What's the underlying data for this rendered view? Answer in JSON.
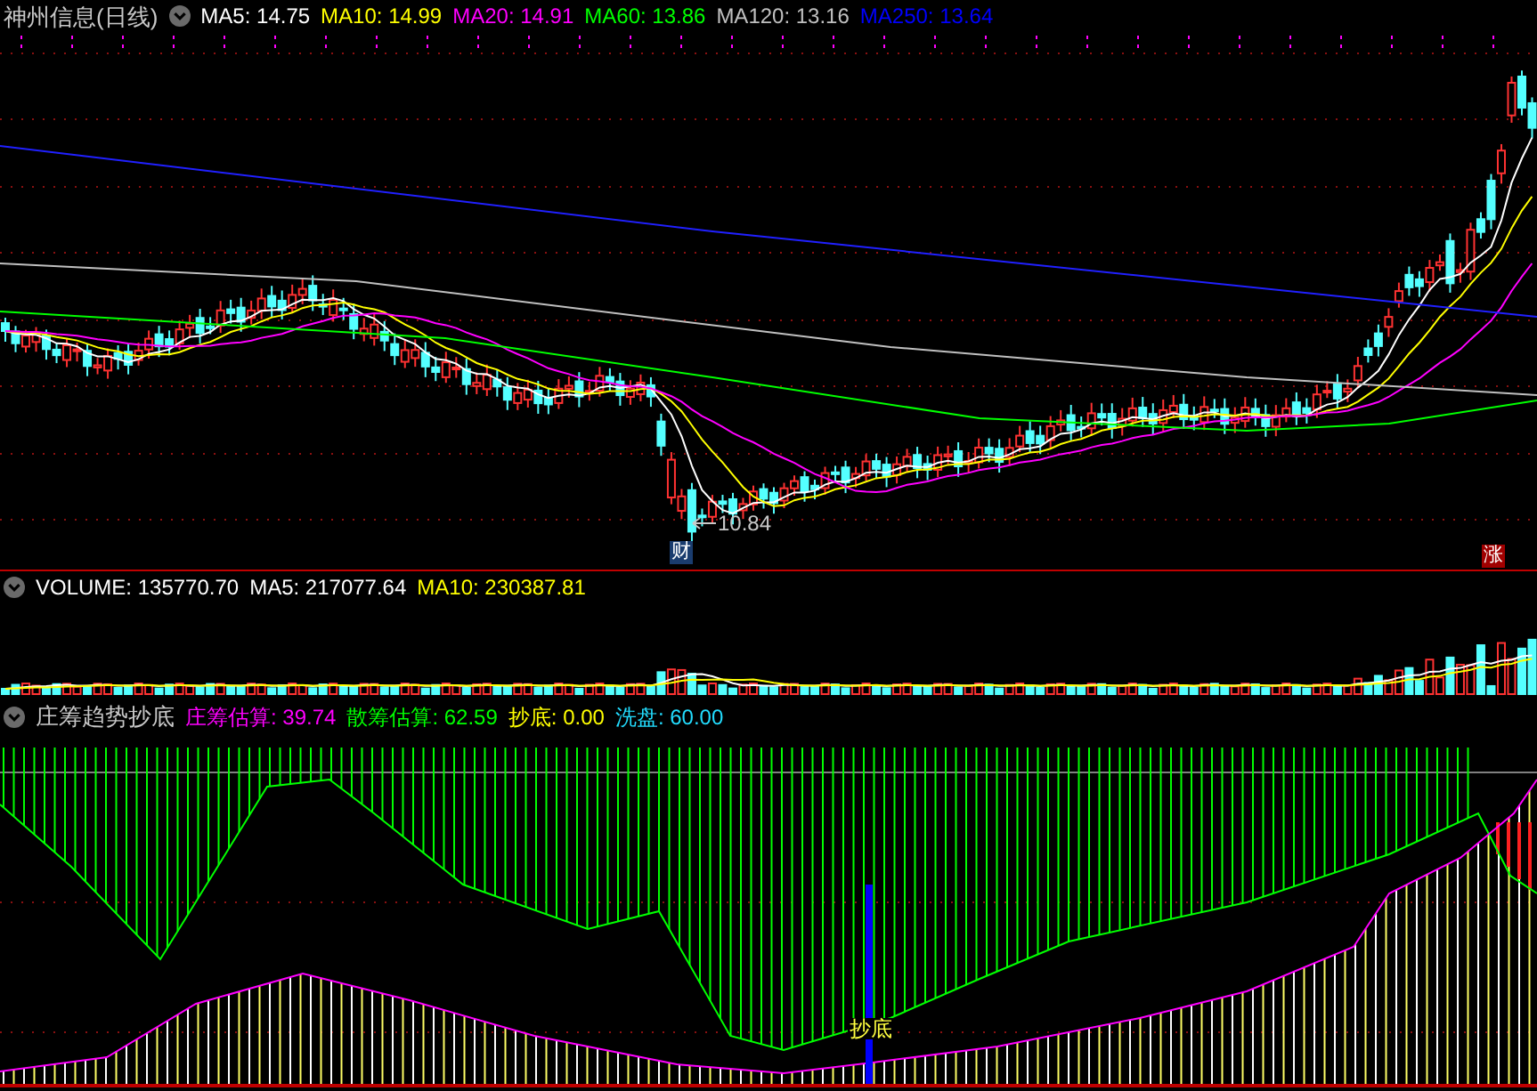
{
  "price_panel": {
    "title": "神州信息(日线)",
    "legend": [
      {
        "text": "MA5: 14.75",
        "color": "#ffffff"
      },
      {
        "text": "MA10: 14.99",
        "color": "#ffff00"
      },
      {
        "text": "MA20: 14.91",
        "color": "#ff00ff"
      },
      {
        "text": "MA60: 13.86",
        "color": "#00ff00"
      },
      {
        "text": "MA120: 13.16",
        "color": "#c0c0c0"
      },
      {
        "text": "MA250: 13.64",
        "color": "#0000ff"
      }
    ],
    "markers": [
      {
        "kind": "badge",
        "text": "财"
      },
      {
        "kind": "low_label",
        "text": "10.84"
      },
      {
        "kind": "badge",
        "text": "涨"
      }
    ]
  },
  "volume_panel": {
    "legend": [
      {
        "text": "VOLUME: 135770.70",
        "color": "#ffffff"
      },
      {
        "text": "MA5: 217077.64",
        "color": "#ffffff"
      },
      {
        "text": "MA10: 230387.81",
        "color": "#ffff00"
      }
    ]
  },
  "indicator_panel": {
    "title": "庄筹趋势抄底",
    "legend": [
      {
        "text": "庄筹估算: 39.74",
        "color": "#ff00ff"
      },
      {
        "text": "散筹估算: 62.59",
        "color": "#00ff00"
      },
      {
        "text": "抄底: 0.00",
        "color": "#ffff00"
      },
      {
        "text": "洗盘: 60.00",
        "color": "#22ddff"
      }
    ],
    "markers": [
      {
        "kind": "signal_label",
        "text": "抄底"
      }
    ]
  }
}
